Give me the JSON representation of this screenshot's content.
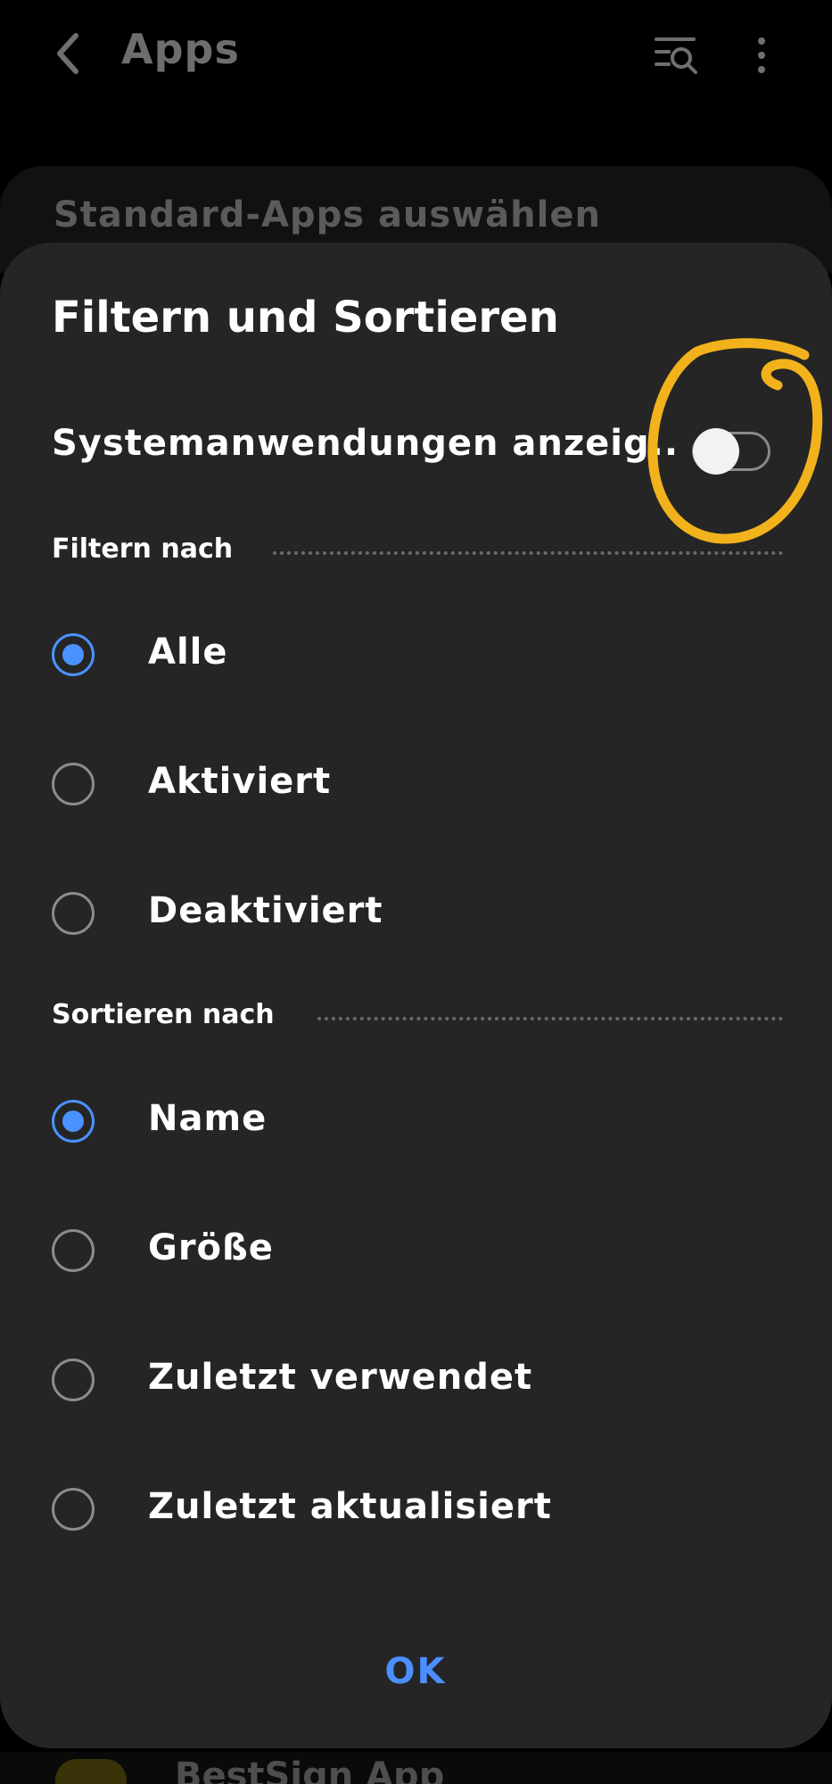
{
  "appbar": {
    "title": "Apps",
    "back_icon": "chevron-left-icon",
    "filter_search_icon": "list-search-icon",
    "more_icon": "more-vertical-icon"
  },
  "background": {
    "card_label": "Standard-Apps auswählen",
    "bottom_item_label": "BestSign App"
  },
  "dialog": {
    "title": "Filtern und Sortieren",
    "show_system_apps": {
      "label": "Systemanwendungen anzeig..",
      "enabled": false
    },
    "filter_section": {
      "header": "Filtern nach",
      "options": [
        {
          "label": "Alle",
          "selected": true
        },
        {
          "label": "Aktiviert",
          "selected": false
        },
        {
          "label": "Deaktiviert",
          "selected": false
        }
      ]
    },
    "sort_section": {
      "header": "Sortieren nach",
      "options": [
        {
          "label": "Name",
          "selected": true
        },
        {
          "label": "Größe",
          "selected": false
        },
        {
          "label": "Zuletzt verwendet",
          "selected": false
        },
        {
          "label": "Zuletzt aktualisiert",
          "selected": false
        }
      ]
    },
    "ok_label": "OK"
  },
  "colors": {
    "accent": "#4a92ff",
    "dialog_bg": "#252525",
    "highlight_annotation": "#f2b21c"
  }
}
